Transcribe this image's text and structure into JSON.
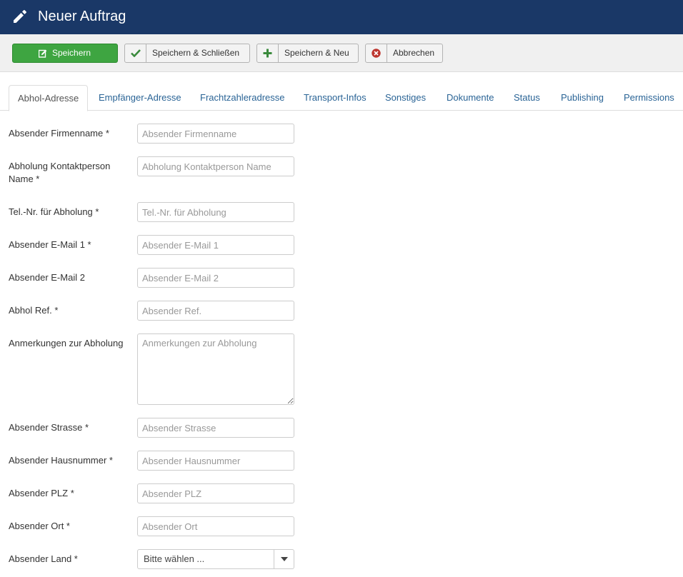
{
  "header": {
    "title": "Neuer Auftrag",
    "icon": "pencil-icon",
    "background": "#1a3867"
  },
  "toolbar": {
    "save_label": "Speichern",
    "save_close_label": "Speichern & Schließen",
    "save_new_label": "Speichern & Neu",
    "cancel_label": "Abbrechen",
    "accent_green": "#3ea541",
    "cancel_red": "#c0392b"
  },
  "tabs": [
    {
      "label": "Abhol-Adresse",
      "active": true
    },
    {
      "label": "Empfänger-Adresse",
      "active": false
    },
    {
      "label": "Frachtzahleradresse",
      "active": false
    },
    {
      "label": "Transport-Infos",
      "active": false
    },
    {
      "label": "Sonstiges",
      "active": false
    },
    {
      "label": "Dokumente",
      "active": false
    },
    {
      "label": "Status",
      "active": false
    },
    {
      "label": "Publishing",
      "active": false
    },
    {
      "label": "Permissions",
      "active": false
    }
  ],
  "form": {
    "fields": [
      {
        "label": "Absender Firmenname *",
        "placeholder": "Absender Firmenname",
        "value": ""
      },
      {
        "label": "Abholung Kontaktperson Name *",
        "placeholder": "Abholung Kontaktperson Name",
        "value": ""
      },
      {
        "label": "Tel.-Nr. für Abholung *",
        "placeholder": "Tel.-Nr. für Abholung",
        "value": ""
      },
      {
        "label": "Absender E-Mail 1 *",
        "placeholder": "Absender E-Mail 1",
        "value": ""
      },
      {
        "label": "Absender E-Mail 2",
        "placeholder": "Absender E-Mail 2",
        "value": ""
      },
      {
        "label": "Abhol Ref. *",
        "placeholder": "Absender Ref.",
        "value": ""
      },
      {
        "label": "Anmerkungen zur Abholung",
        "placeholder": "Anmerkungen zur Abholung",
        "value": ""
      },
      {
        "label": "Absender Strasse *",
        "placeholder": "Absender Strasse",
        "value": ""
      },
      {
        "label": "Absender Hausnummer *",
        "placeholder": "Absender Hausnummer",
        "value": ""
      },
      {
        "label": "Absender PLZ *",
        "placeholder": "Absender PLZ",
        "value": ""
      },
      {
        "label": "Absender Ort *",
        "placeholder": "Absender Ort",
        "value": ""
      }
    ],
    "country": {
      "label": "Absender Land *",
      "selected": "Bitte wählen ..."
    }
  }
}
